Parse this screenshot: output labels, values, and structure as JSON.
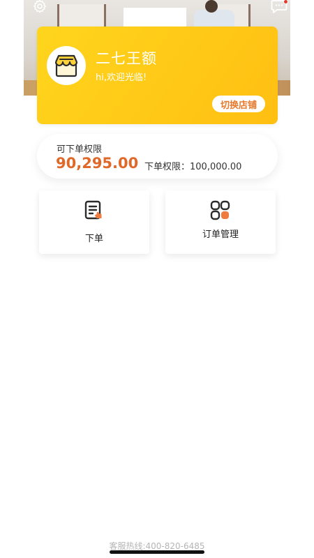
{
  "header": {
    "settings_icon": "gear-icon",
    "messages_icon": "message-icon",
    "has_unread": true
  },
  "store": {
    "name": "二七王额",
    "greeting": "hi,欢迎光临!",
    "switch_label": "切换店铺",
    "avatar_icon": "store-icon"
  },
  "limit": {
    "label": "可下单权限",
    "value": "90,295.00",
    "total": "下单权限：100,000.00"
  },
  "actions": [
    {
      "label": "下单",
      "icon": "order-form-icon"
    },
    {
      "label": "订单管理",
      "icon": "order-manage-icon"
    }
  ],
  "footer": {
    "hotline": "客服热线:400-820-6485"
  },
  "colors": {
    "accent": "#ffc917",
    "highlight": "#e0692a",
    "switch_text": "#e8782a"
  }
}
